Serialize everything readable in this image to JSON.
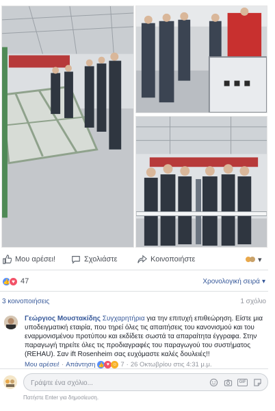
{
  "actions": {
    "like_label": "Μου αρέσει!",
    "comment_label": "Σχολιάστε",
    "share_label": "Κοινοποιήστε"
  },
  "reactions": {
    "count": "47",
    "sort_label": "Χρονολογική σειρά"
  },
  "shares": {
    "label": "3 κοινοποιήσεις",
    "comments_count": "1 σχόλιο"
  },
  "comment": {
    "author": "Γεώργιος Μουστακίδης",
    "tag": "Συγχαρητήρια",
    "text": " για την επιτυχή επιθεώρηση. Είστε μια υποδειγματική εταιρία, που τηρεί όλες τις απαιτήσεις του κανονισμού και του εναρμονισμένου προτύπου και εκδίδετε σωστά τα απαραίτητα έγγραφα. Στην παραγωγή τηρείτε όλες τις προδιαγραφές του παραγωγού του συστήματος (REHAU). Σαν ift Rosenheim σας ευχόμαστε καλές δουλειές!!",
    "like_link": "Μου αρέσει!",
    "separator": "·",
    "reply_link": "Απάντηση",
    "reaction_count": "7",
    "separator2": "·",
    "timestamp": "26 Οκτωβρίου στις 4:31 μ.μ."
  },
  "write_comment": {
    "placeholder": "Γράψτε ένα σχόλιο...",
    "hint": "Πατήστε Enter για δημοσίευση."
  },
  "icons": {
    "like": "thumbs-up-icon",
    "comment": "speech-bubble-icon",
    "share": "share-arrow-icon",
    "audience": "audience-icon",
    "emoji": "smiley-icon",
    "camera": "camera-icon",
    "gif": "gif-icon",
    "sticker": "sticker-icon"
  },
  "colors": {
    "link": "#365899",
    "muted": "#90949c",
    "like_blue": "#5890ff",
    "love_red": "#f25268"
  }
}
